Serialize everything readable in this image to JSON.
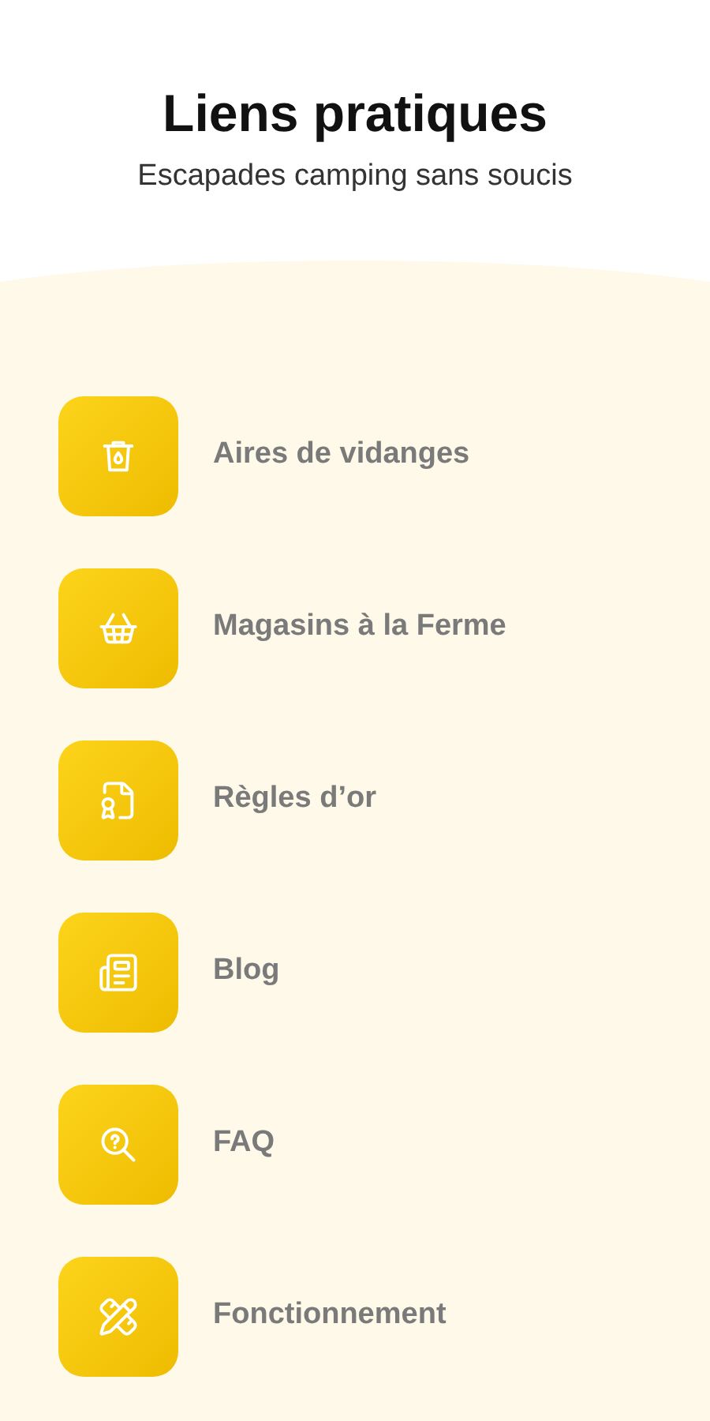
{
  "header": {
    "title": "Liens pratiques",
    "subtitle": "Escapades camping sans soucis"
  },
  "links": [
    {
      "kind": "dump",
      "label": "Aires de vidanges"
    },
    {
      "kind": "basket",
      "label": "Magasins à la Ferme"
    },
    {
      "kind": "rules",
      "label": "Règles d’or"
    },
    {
      "kind": "blog",
      "label": "Blog"
    },
    {
      "kind": "faq",
      "label": "FAQ"
    },
    {
      "kind": "tools",
      "label": "Fonctionnement"
    }
  ]
}
